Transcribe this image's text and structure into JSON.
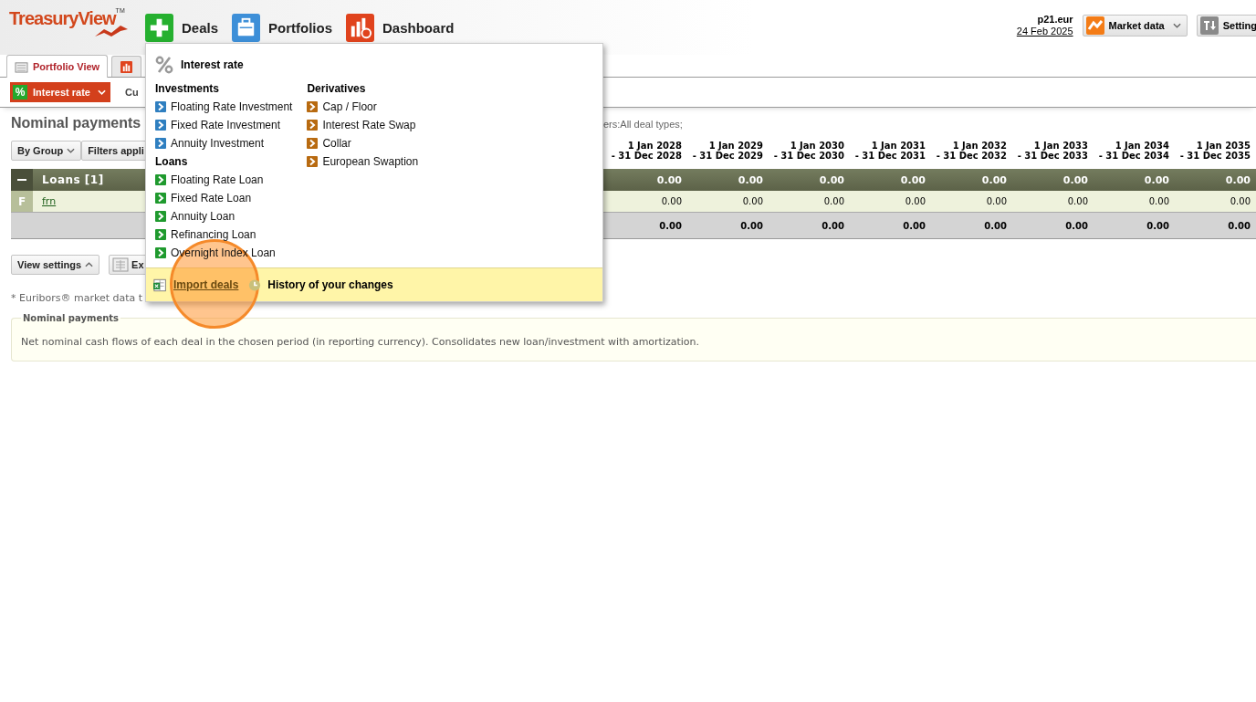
{
  "header": {
    "logo": {
      "name": "TreasuryView",
      "mark": "TM"
    },
    "nav": [
      {
        "label": "Deals"
      },
      {
        "label": "Portfolios"
      },
      {
        "label": "Dashboard"
      }
    ],
    "user": {
      "name": "p21.eur",
      "date": "24 Feb 2025"
    },
    "buttons": [
      {
        "label": "Market data",
        "kind": "market"
      },
      {
        "label": "Setting",
        "kind": "settings"
      }
    ]
  },
  "tabs": [
    {
      "label": "Portfolio View",
      "selected": true
    },
    {
      "selected": false
    }
  ],
  "toolbar": {
    "asset_class": "Interest rate",
    "asset_symbol": "%",
    "next_label": "Cu"
  },
  "report": {
    "title": "Nominal payments",
    "filter_note": "ers:All deal types;",
    "controls": [
      "By Group",
      "Filters appli"
    ],
    "table": {
      "columns": [
        {
          "from": "1 Jan 2028",
          "to": "- 31 Dec 2028"
        },
        {
          "from": "1 Jan 2029",
          "to": "- 31 Dec 2029"
        },
        {
          "from": "1 Jan 2030",
          "to": "- 31 Dec 2030"
        },
        {
          "from": "1 Jan 2031",
          "to": "- 31 Dec 2031"
        },
        {
          "from": "1 Jan 2032",
          "to": "- 31 Dec 2032"
        },
        {
          "from": "1 Jan 2033",
          "to": "- 31 Dec 2033"
        },
        {
          "from": "1 Jan 2034",
          "to": "- 31 Dec 2034"
        },
        {
          "from": "1 Jan 2035",
          "to": "- 31 Dec 2035"
        }
      ],
      "groups": [
        {
          "label": "Loans [1]",
          "expanded": true,
          "totals": [
            "0.00",
            "0.00",
            "0.00",
            "0.00",
            "0.00",
            "0.00",
            "0.00",
            "0.00"
          ],
          "rows": [
            {
              "code": "F",
              "name": "frn",
              "values": [
                "0.00",
                "0.00",
                "0.00",
                "0.00",
                "0.00",
                "0.00",
                "0.00",
                "0.00"
              ]
            }
          ]
        }
      ],
      "totals": [
        "0.00",
        "0.00",
        "0.00",
        "0.00",
        "0.00",
        "0.00",
        "0.00",
        "0.00"
      ]
    },
    "view_settings": "View settings",
    "export": "Ex",
    "footnote": "* Euribors® market data t",
    "info": {
      "title": "Nominal payments",
      "text": "Net nominal cash flows of each deal in the chosen period (in reporting currency). Consolidates new loan/investment with amortization."
    }
  },
  "menu": {
    "title": "Interest rate",
    "columns": [
      [
        {
          "heading": "Investments",
          "items": [
            {
              "label": "Floating Rate Investment",
              "kind": "investment"
            },
            {
              "label": "Fixed Rate Investment",
              "kind": "investment"
            },
            {
              "label": "Annuity Investment",
              "kind": "investment"
            }
          ]
        },
        {
          "heading": "Loans",
          "items": [
            {
              "label": "Floating Rate Loan",
              "kind": "loan"
            },
            {
              "label": "Fixed Rate Loan",
              "kind": "loan"
            },
            {
              "label": "Annuity Loan",
              "kind": "loan"
            },
            {
              "label": "Refinancing Loan",
              "kind": "loan"
            },
            {
              "label": "Overnight Index Loan",
              "kind": "loan"
            }
          ]
        }
      ],
      [
        {
          "heading": "Derivatives",
          "items": [
            {
              "label": "Cap / Floor",
              "kind": "derivative"
            },
            {
              "label": "Interest Rate Swap",
              "kind": "derivative"
            },
            {
              "label": "Collar",
              "kind": "derivative"
            },
            {
              "label": "European Swaption",
              "kind": "derivative"
            }
          ]
        }
      ]
    ],
    "footer": [
      {
        "label": "Import deals",
        "kind": "import"
      },
      {
        "label": "History of your changes",
        "kind": "history"
      }
    ]
  },
  "annotation": {
    "kind": "spotlight"
  }
}
